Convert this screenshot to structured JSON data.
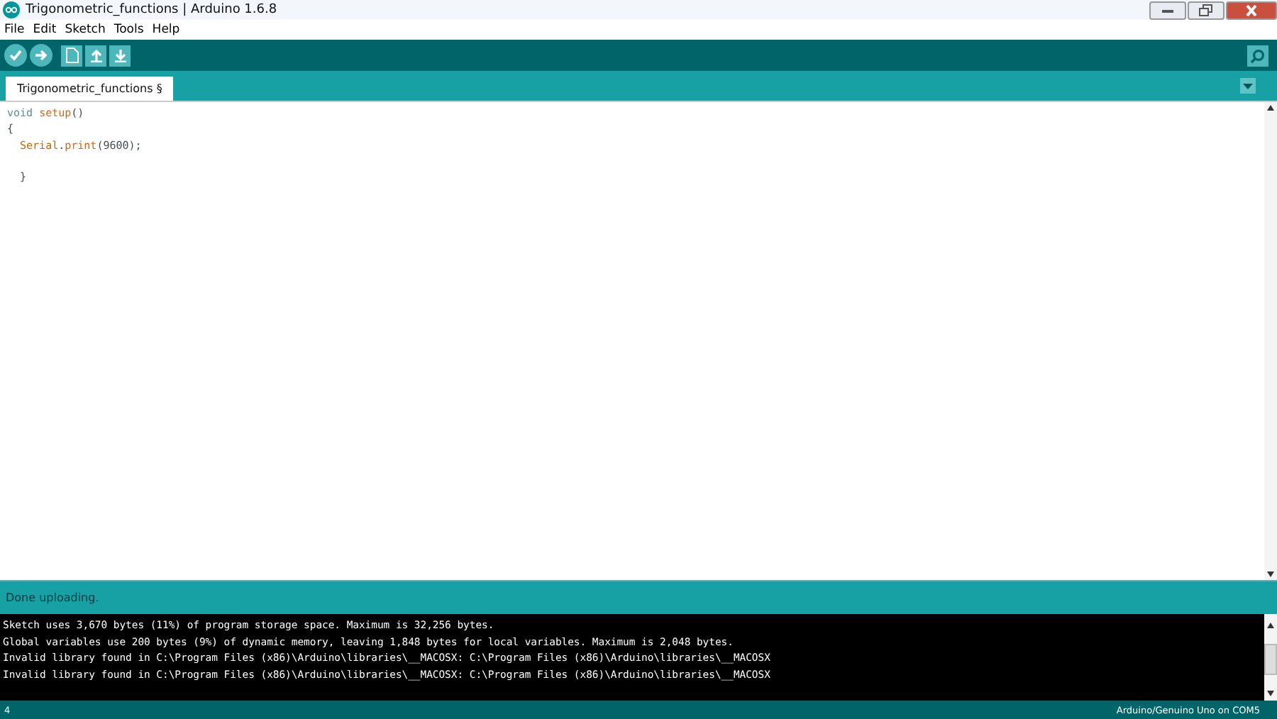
{
  "window": {
    "title": "Trigonometric_functions | Arduino 1.6.8"
  },
  "menu": [
    "File",
    "Edit",
    "Sketch",
    "Tools",
    "Help"
  ],
  "tabs": [
    {
      "label": "Trigonometric_functions §",
      "selected": true
    }
  ],
  "editor": {
    "lines": [
      {
        "tokens": [
          {
            "text": "void",
            "kind": "keyword"
          },
          {
            "text": "setup",
            "kind": "function"
          },
          {
            "text": "()",
            "kind": "plain"
          }
        ]
      },
      {
        "tokens": [
          {
            "text": "{",
            "kind": "plain"
          }
        ]
      },
      {
        "indent": true,
        "tokens": [
          {
            "text": "Serial",
            "kind": "class"
          },
          {
            "text": ".",
            "kind": "plain"
          },
          {
            "text": "print",
            "kind": "function"
          },
          {
            "text": "(9600);",
            "kind": "plain"
          }
        ]
      },
      {
        "indent": true,
        "gap_before": true,
        "tokens": [
          {
            "text": "}",
            "kind": "plain"
          }
        ]
      }
    ]
  },
  "status": "Done uploading.",
  "console": [
    "Sketch uses 3,670 bytes (11%) of program storage space. Maximum is 32,256 bytes.",
    "Global variables use 200 bytes (9%) of dynamic memory, leaving 1,848 bytes for local variables. Maximum is 2,048 bytes.",
    "Invalid library found in C:\\Program Files (x86)\\Arduino\\libraries\\__MACOSX: C:\\Program Files (x86)\\Arduino\\libraries\\__MACOSX",
    "Invalid library found in C:\\Program Files (x86)\\Arduino\\libraries\\__MACOSX: C:\\Program Files (x86)\\Arduino\\libraries\\__MACOSX"
  ],
  "footer": {
    "line": "4",
    "board": "Arduino/Genuino Uno on COM5"
  }
}
